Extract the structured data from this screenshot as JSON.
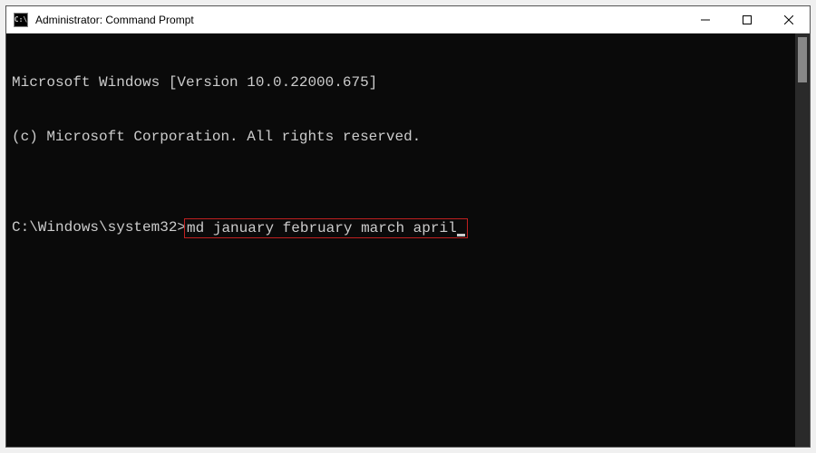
{
  "window": {
    "title": "Administrator: Command Prompt",
    "icon_label": "C:\\"
  },
  "terminal": {
    "line1": "Microsoft Windows [Version 10.0.22000.675]",
    "line2": "(c) Microsoft Corporation. All rights reserved.",
    "blank": "",
    "prompt": "C:\\Windows\\system32>",
    "command": "md january february march april"
  },
  "annotation": {
    "highlight_color": "#c02020"
  }
}
